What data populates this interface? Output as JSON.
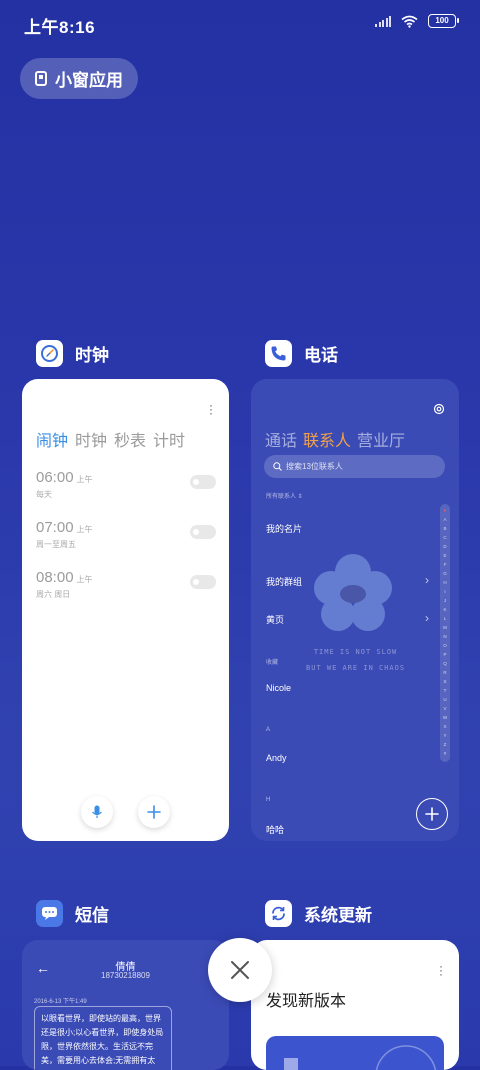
{
  "status": {
    "time": "上午8:16",
    "battery": "100"
  },
  "mini_window": {
    "label": "小窗应用"
  },
  "apps": {
    "clock": {
      "name": "时钟",
      "tabs": [
        "闹钟",
        "时钟",
        "秒表",
        "计时"
      ],
      "alarms": [
        {
          "time": "06:00",
          "ampm": "上午",
          "repeat": "每天"
        },
        {
          "time": "07:00",
          "ampm": "上午",
          "repeat": "周一至周五"
        },
        {
          "time": "08:00",
          "ampm": "上午",
          "repeat": "周六 周日"
        }
      ]
    },
    "phone": {
      "name": "电话",
      "tabs": [
        "通话",
        "联系人",
        "营业厅"
      ],
      "search_placeholder": "搜索13位联系人",
      "all_contacts": "所有联系人",
      "my_card": "我的名片",
      "my_groups": "我的群组",
      "yellow_pages": "黄页",
      "section_favorite": "收藏",
      "contact_1": "Nicole",
      "section_a": "A",
      "contact_2": "Andy",
      "section_h": "H",
      "contact_3": "哈哈",
      "slogan_1": "TIME IS NOT SLOW",
      "slogan_2": "BUT WE ARE IN CHAOS",
      "alphabet": [
        "♥",
        "A",
        "B",
        "C",
        "D",
        "E",
        "F",
        "G",
        "H",
        "I",
        "J",
        "K",
        "L",
        "M",
        "N",
        "O",
        "P",
        "Q",
        "R",
        "S",
        "T",
        "U",
        "V",
        "W",
        "X",
        "Y",
        "Z",
        "#"
      ]
    },
    "sms": {
      "name": "短信",
      "contact_name": "倩倩",
      "contact_number": "18730218809",
      "timestamp": "2016-6-13 下午1:49",
      "message": "以眼看世界，即使站的最高，世界还是很小;以心看世界，即使身处局限，世界依然很大。生活远不完美，需要用心去体会;无需拥有太"
    },
    "update": {
      "name": "系统更新",
      "headline": "发现新版本"
    }
  },
  "colors": {
    "background": "#2431a3",
    "accent_blue": "#3a8ee6",
    "accent_orange": "#f0a048"
  }
}
